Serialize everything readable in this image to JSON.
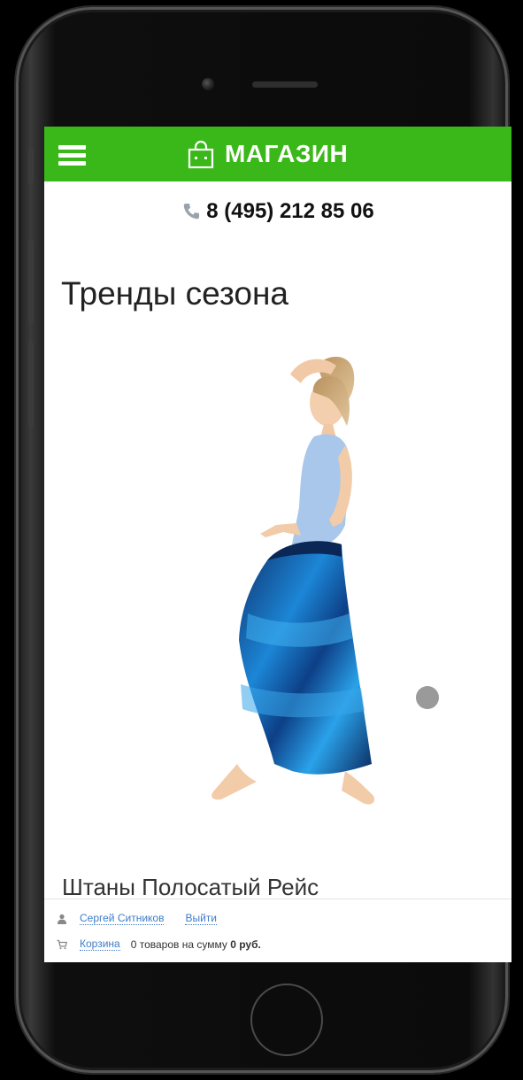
{
  "header": {
    "brand": "МАГАЗИН",
    "menu_icon": "hamburger-menu-icon",
    "bag_icon": "shopping-bag-icon",
    "bar_color": "#3ab819"
  },
  "contact": {
    "phone_icon": "phone-handset-icon",
    "phone": "8 (495) 212 85 06"
  },
  "main": {
    "section_title": "Тренды сезона",
    "product_name": "Штаны Полосатый Рейс",
    "carousel": {
      "dot_color": "#9a9a9a"
    }
  },
  "footer": {
    "user_icon": "user-icon",
    "user_name": "Сергей Ситников",
    "logout": "Выйти",
    "cart_icon": "cart-icon",
    "cart_label": "Корзина",
    "cart_summary_prefix": "0 товаров на сумму",
    "cart_summary_value": "0 руб.",
    "link_color": "#3d7cc9"
  }
}
